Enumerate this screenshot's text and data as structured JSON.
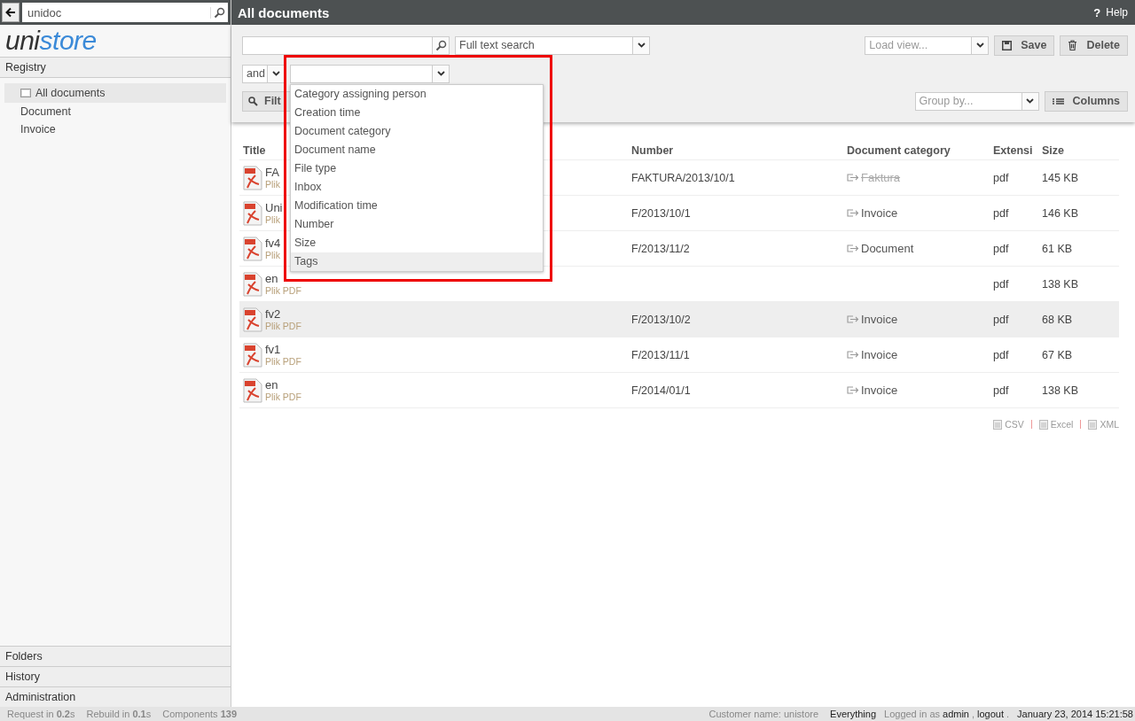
{
  "nav_search": {
    "value": "unidoc"
  },
  "logo": {
    "first": "uni",
    "second": "store"
  },
  "sidebar": {
    "section": "Registry",
    "items": [
      {
        "label": "All documents",
        "kind": "view",
        "selected": true
      },
      {
        "label": "Document",
        "kind": "category",
        "selected": false
      },
      {
        "label": "Invoice",
        "kind": "category",
        "selected": false
      }
    ],
    "bottom_sections": [
      "Folders",
      "History",
      "Administration"
    ]
  },
  "header": {
    "title": "All documents",
    "help_mark": "?",
    "help": "Help"
  },
  "toolbar": {
    "search_mode": "Full text search",
    "load_view": {
      "placeholder": "Load view..."
    },
    "save": "Save",
    "delete": "Delete",
    "operator": "and",
    "filter": "Filt",
    "group_by": {
      "placeholder": "Group by..."
    },
    "columns": "Columns"
  },
  "field_dropdown": {
    "options": [
      {
        "label": "Category assigning person",
        "selected": false
      },
      {
        "label": "Creation time",
        "selected": false
      },
      {
        "label": "Document category",
        "selected": false
      },
      {
        "label": "Document name",
        "selected": false
      },
      {
        "label": "File type",
        "selected": false
      },
      {
        "label": "Inbox",
        "selected": false
      },
      {
        "label": "Modification time",
        "selected": false
      },
      {
        "label": "Number",
        "selected": false
      },
      {
        "label": "Size",
        "selected": false
      },
      {
        "label": "Tags",
        "selected": true
      }
    ]
  },
  "table": {
    "columns": [
      "Title",
      "Number",
      "Document category",
      "Extensi",
      "Size"
    ],
    "rows": [
      {
        "title": "FA",
        "subtitle": "Plik",
        "number": "FAKTURA/2013/10/1",
        "category": "Faktura",
        "category_deleted": true,
        "extension": "pdf",
        "size": "145 KB",
        "selected": false
      },
      {
        "title": "Uni",
        "subtitle": "Plik",
        "number": "F/2013/10/1",
        "category": "Invoice",
        "category_deleted": false,
        "extension": "pdf",
        "size": "146 KB",
        "selected": false
      },
      {
        "title": "fv4",
        "subtitle": "Plik",
        "number": "F/2013/11/2",
        "category": "Document",
        "category_deleted": false,
        "extension": "pdf",
        "size": "61 KB",
        "selected": false
      },
      {
        "title": "en",
        "subtitle": "Plik PDF",
        "extension": "pdf",
        "size": "138 KB",
        "selected": false
      },
      {
        "title": "fv2",
        "subtitle": "Plik PDF",
        "number": "F/2013/10/2",
        "category": "Invoice",
        "category_deleted": false,
        "extension": "pdf",
        "size": "68 KB",
        "selected": true
      },
      {
        "title": "fv1",
        "subtitle": "Plik PDF",
        "number": "F/2013/11/1",
        "category": "Invoice",
        "category_deleted": false,
        "extension": "pdf",
        "size": "67 KB",
        "selected": false
      },
      {
        "title": "en",
        "subtitle": "Plik PDF",
        "number": "F/2014/01/1",
        "category": "Invoice",
        "category_deleted": false,
        "extension": "pdf",
        "size": "138 KB",
        "selected": false
      }
    ]
  },
  "exports": [
    "CSV",
    "Excel",
    "XML"
  ],
  "status_bar": {
    "left": [
      "Request in **0.2**s",
      "Rebuild in **0.1**s",
      "Components **139**"
    ],
    "customer": "Customer name: unistore",
    "scope": "Everything",
    "logged_in": "Logged in as",
    "user": "admin",
    "separator": ",",
    "logout": "logout",
    "end": ".",
    "datetime": "January 23, 2014 15:21:58"
  }
}
